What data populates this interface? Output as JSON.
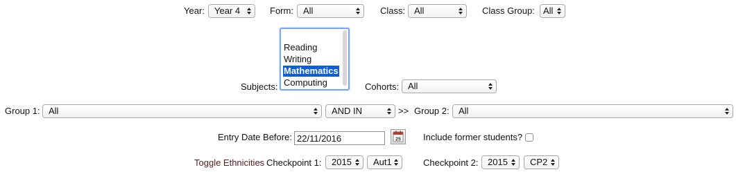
{
  "filters": {
    "year": {
      "label": "Year:",
      "value": "Year 4"
    },
    "form": {
      "label": "Form:",
      "value": "All"
    },
    "class": {
      "label": "Class:",
      "value": "All"
    },
    "class_group": {
      "label": "Class Group:",
      "value": "All"
    }
  },
  "subjects": {
    "label": "Subjects:",
    "options": [
      "Reading",
      "Writing",
      "Mathematics",
      "Computing"
    ],
    "selected": "Mathematics"
  },
  "cohorts": {
    "label": "Cohorts:",
    "value": "All"
  },
  "groups": {
    "group1_label": "Group 1:",
    "group1_value": "All",
    "operator_value": "AND IN",
    "separator": ">>",
    "group2_label": "Group 2:",
    "group2_value": "All"
  },
  "entry_date": {
    "label": "Entry Date Before:",
    "value": "22/11/2016",
    "calendar_day": "25"
  },
  "include_former": {
    "label": "Include former students?",
    "checked": false
  },
  "checkpoints": {
    "toggle_link": "Toggle Ethnicities",
    "cp1_label": "Checkpoint 1:",
    "cp1_year": "2015",
    "cp1_term": "Aut1",
    "cp2_label": "Checkpoint 2:",
    "cp2_year": "2015",
    "cp2_term": "CP2"
  },
  "colors": {
    "accent": "#0b5ed7",
    "link": "#5a1a22",
    "focus_ring": "#7aa7f0"
  }
}
